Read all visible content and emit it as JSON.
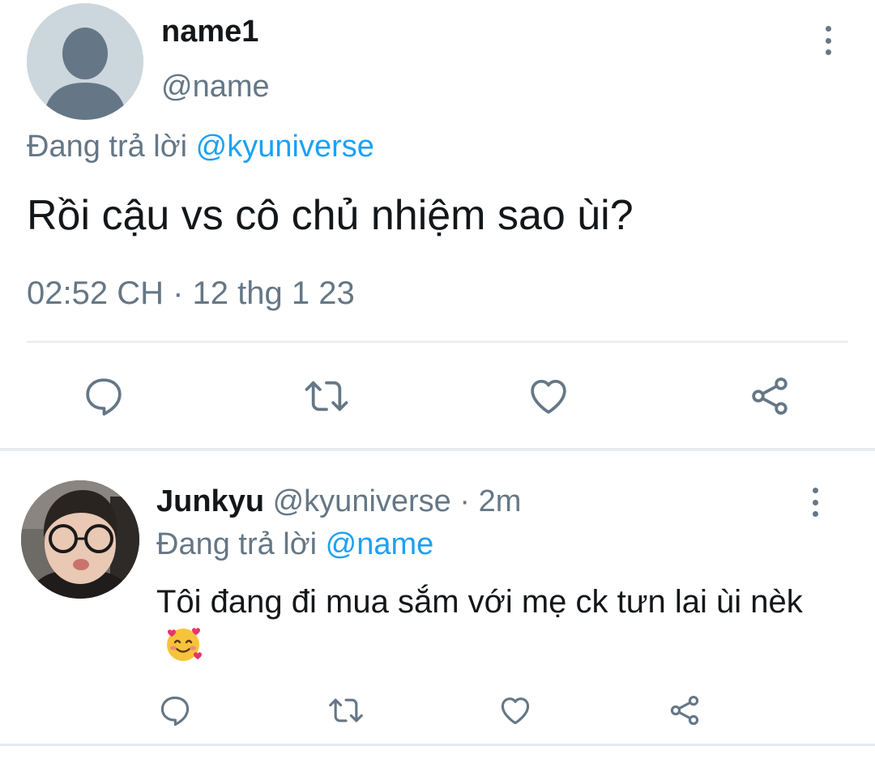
{
  "main_tweet": {
    "author_name": "name1",
    "author_handle": "@name",
    "replying_prefix": "Đang trả lời",
    "replying_to": "@kyuniverse",
    "text": "Rồi cậu vs cô chủ nhiệm sao ùi?",
    "timestamp": "02:52 CH · 12 thg 1 23",
    "actions": [
      "reply-icon",
      "retweet-icon",
      "like-icon",
      "share-icon"
    ]
  },
  "reply_tweet": {
    "author_name": "Junkyu",
    "author_handle_time": "@kyuniverse · 2m",
    "replying_prefix": "Đang trả lời",
    "replying_to": "@name",
    "text": "Tôi đang đi mua sắm với mẹ ck tưn lai ùi nèk",
    "emoji": "smiling-face-with-hearts",
    "actions": [
      "reply-icon",
      "retweet-icon",
      "like-icon",
      "share-icon"
    ]
  },
  "colors": {
    "accent": "#1da1f2",
    "secondary_text": "#657786",
    "primary_text": "#14171a",
    "divider": "#e6ecf0",
    "icon": "#657786"
  }
}
